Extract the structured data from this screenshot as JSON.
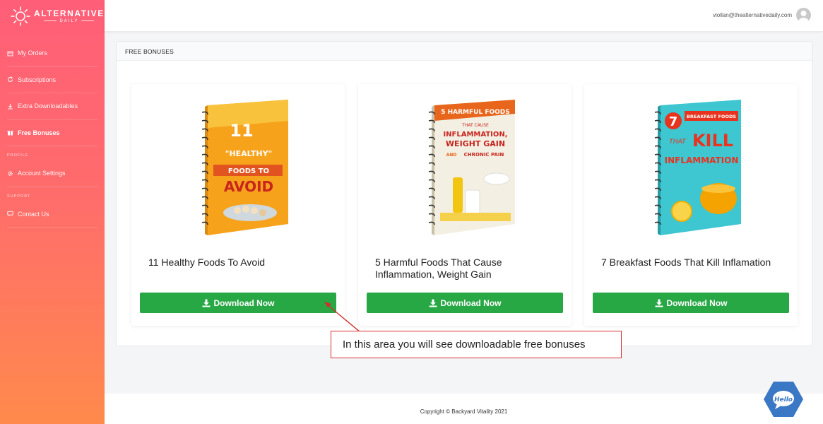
{
  "brand": {
    "name": "ALTERNATIVE",
    "sub": "DAILY"
  },
  "sidebar": {
    "items": [
      {
        "label": "My Orders",
        "icon": "package-icon"
      },
      {
        "label": "Subscriptions",
        "icon": "refresh-icon"
      },
      {
        "label": "Extra Downloadables",
        "icon": "download-icon"
      },
      {
        "label": "Free Bonuses",
        "icon": "gift-icon"
      }
    ],
    "profile_heading": "PROFILE",
    "profile_items": [
      {
        "label": "Account Settings",
        "icon": "gear-icon"
      }
    ],
    "support_heading": "SUPPORT",
    "support_items": [
      {
        "label": "Contact Us",
        "icon": "chat-icon"
      }
    ]
  },
  "header": {
    "user_email": "viollan@thealternativedaily.com"
  },
  "panel": {
    "title": "FREE BONUSES",
    "cards": [
      {
        "title": "11 Healthy Foods To Avoid",
        "button": "Download Now",
        "cover": {
          "line1": "11",
          "line2": "\"HEALTHY\"",
          "line3": "FOODS TO",
          "line4": "AVOID",
          "bg": "#f7a21b"
        }
      },
      {
        "title": "5 Harmful Foods That Cause Inflammation, Weight Gain",
        "button": "Download Now",
        "cover": {
          "line1": "5 HARMFUL FOODS",
          "line2": "THAT CAUSE",
          "line3": "INFLAMMATION,",
          "line4": "WEIGHT GAIN",
          "line5": "AND",
          "line6": "CHRONIC PAIN",
          "bg": "#f3efe2"
        }
      },
      {
        "title": "7 Breakfast Foods That Kill Inflamation",
        "button": "Download Now",
        "cover": {
          "line1": "7",
          "line2": "BREAKFAST FOODS",
          "line3": "THAT",
          "line4": "KILL",
          "line5": "INFLAMMATION",
          "bg": "#3ec6d1"
        }
      }
    ]
  },
  "annotation": {
    "text": "In this area you will see downloadable free bonuses"
  },
  "footer": {
    "text": "Copyright © Backyard Vitality 2021"
  },
  "chat": {
    "label": "Hello"
  },
  "colors": {
    "accent": "#28a745",
    "sidebar_top": "#ff5e78",
    "sidebar_bottom": "#ff8a4c",
    "callout_border": "#d32f2f"
  }
}
